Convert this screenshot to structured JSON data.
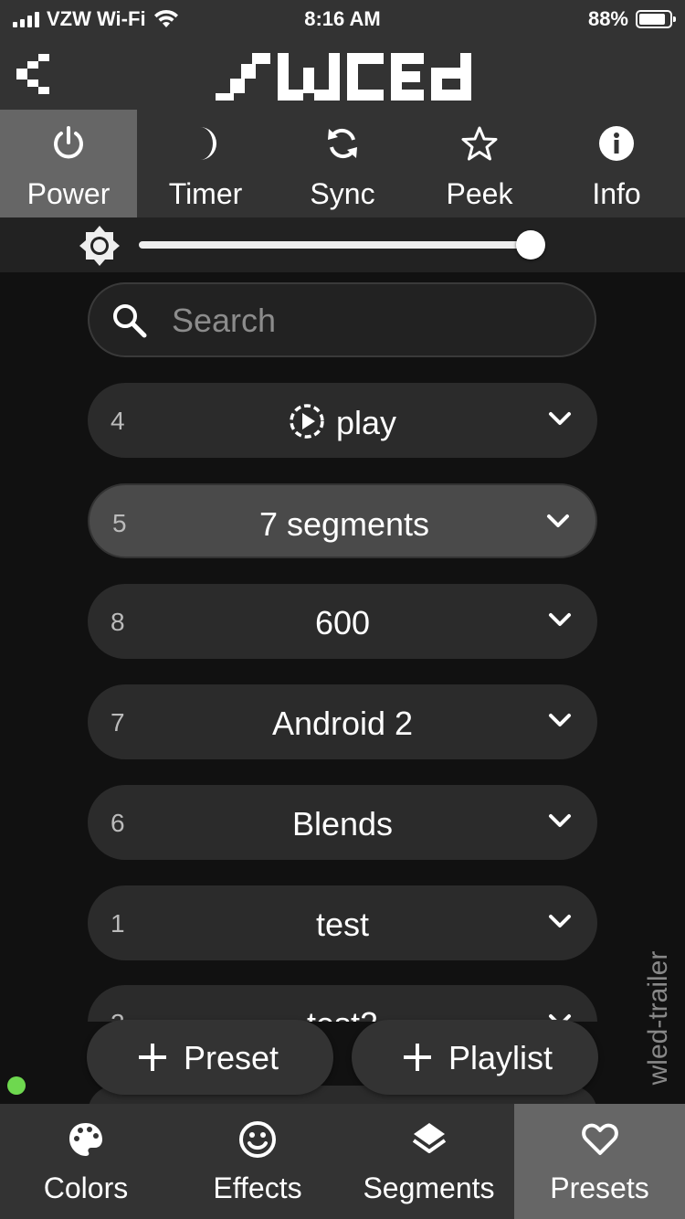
{
  "status_bar": {
    "carrier": "VZW Wi-Fi",
    "time": "8:16 AM",
    "battery": "88%",
    "battery_level": 0.88
  },
  "header": {
    "back_icon": "chevron-left-icon",
    "logo_icon": "wled-logo"
  },
  "top_nav": [
    {
      "label": "Power",
      "icon": "power-icon",
      "active": true
    },
    {
      "label": "Timer",
      "icon": "moon-icon",
      "active": false
    },
    {
      "label": "Sync",
      "icon": "sync-icon",
      "active": false
    },
    {
      "label": "Peek",
      "icon": "star-icon",
      "active": false
    },
    {
      "label": "Info",
      "icon": "info-icon",
      "active": false
    }
  ],
  "brightness": {
    "icon": "brightness-icon",
    "level": 1.0
  },
  "search": {
    "placeholder": "Search",
    "value": ""
  },
  "presets": [
    {
      "id": "4",
      "name": "play",
      "icon": "playlist-icon",
      "selected": false
    },
    {
      "id": "5",
      "name": "7 segments",
      "selected": true
    },
    {
      "id": "8",
      "name": "600",
      "selected": false
    },
    {
      "id": "7",
      "name": "Android 2",
      "selected": false
    },
    {
      "id": "6",
      "name": "Blends",
      "selected": false
    },
    {
      "id": "1",
      "name": "test",
      "selected": false
    },
    {
      "id": "2",
      "name": "test2",
      "selected": false
    }
  ],
  "actions": {
    "add_preset": "Preset",
    "add_playlist": "Playlist"
  },
  "hostname": "wled-trailer",
  "connection_color": "#6ed84f",
  "bottom_nav": [
    {
      "label": "Colors",
      "icon": "palette-icon",
      "active": false
    },
    {
      "label": "Effects",
      "icon": "smiley-icon",
      "active": false
    },
    {
      "label": "Segments",
      "icon": "layers-icon",
      "active": false
    },
    {
      "label": "Presets",
      "icon": "heart-icon",
      "active": true
    }
  ]
}
